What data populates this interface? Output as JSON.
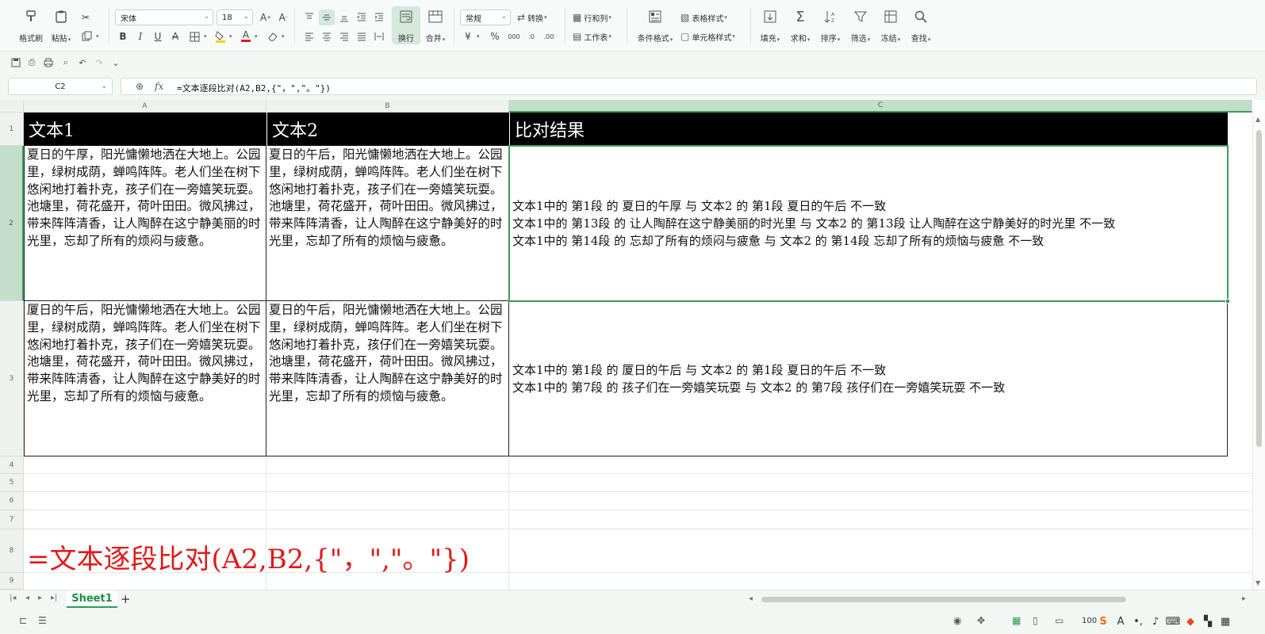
{
  "ribbon": {
    "format_painter": "格式刷",
    "paste": "粘贴",
    "font_name": "宋体",
    "font_size": "18",
    "wrap_text": "换行",
    "merge": "合并",
    "number_format": "常规",
    "convert": "转换",
    "rows_cols": "行和列",
    "worksheet": "工作表",
    "conditional_format": "条件格式",
    "table_style": "表格样式",
    "cell_style": "单元格样式",
    "fill": "填充",
    "sum": "求和",
    "sort": "排序",
    "filter": "筛选",
    "freeze": "冻结",
    "find": "查找",
    "currency_symbol": "¥",
    "percent_symbol": "%"
  },
  "formula_bar": {
    "name_box": "C2",
    "formula": "=文本逐段比对(A2,B2,{\"，\",\"。\"})"
  },
  "columns": [
    "A",
    "B",
    "C"
  ],
  "rows": [
    "1",
    "2",
    "3",
    "4",
    "5",
    "6",
    "7",
    "8",
    "9"
  ],
  "cells": {
    "A1": "文本1",
    "B1": "文本2",
    "C1": "比对结果",
    "A2": "夏日的午厚，阳光慵懒地洒在大地上。公园里，绿树成荫，蝉鸣阵阵。老人们坐在树下悠闲地打着扑克，孩子们在一旁嬉笑玩耍。池塘里，荷花盛开，荷叶田田。微风拂过，带来阵阵清香，让人陶醉在这宁静美丽的时光里，忘却了所有的烦闷与疲惫。",
    "B2": "夏日的午后，阳光慵懒地洒在大地上。公园里，绿树成荫，蝉鸣阵阵。老人们坐在树下悠闲地打着扑克，孩子们在一旁嬉笑玩耍。池塘里，荷花盛开，荷叶田田。微风拂过，带来阵阵清香，让人陶醉在这宁静美好的时光里，忘却了所有的烦恼与疲惫。",
    "C2": [
      "文本1中的 第1段 的 夏日的午厚 与 文本2 的 第1段 夏日的午后 不一致",
      "文本1中的 第13段 的 让人陶醉在这宁静美丽的时光里 与 文本2 的 第13段 让人陶醉在这宁静美好的时光里 不一致",
      "文本1中的 第14段 的 忘却了所有的烦闷与疲惫 与 文本2 的 第14段 忘却了所有的烦恼与疲惫 不一致"
    ],
    "A3": "厦日的午后，阳光慵懒地洒在大地上。公园里，绿树成荫，蝉鸣阵阵。老人们坐在树下悠闲地打着扑克，孩子们在一旁嬉笑玩耍。池塘里，荷花盛开，荷叶田田。微风拂过，带来阵阵清香，让人陶醉在这宁静美好的时光里，忘却了所有的烦恼与疲惫。",
    "B3": "夏日的午后，阳光慵懒地洒在大地上。公园里，绿树成荫，蝉鸣阵阵。老人们坐在树下悠闲地打着扑克，孩仔们在一旁嬉笑玩耍。池塘里，荷花盛开，荷叶田田。微风拂过，带来阵阵清香，让人陶醉在这宁静美好的时光里，忘却了所有的烦恼与疲惫。",
    "C3": [
      "文本1中的 第1段 的 厦日的午后 与 文本2 的 第1段 夏日的午后 不一致",
      "文本1中的 第7段 的 孩子们在一旁嬉笑玩耍 与 文本2 的 第7段 孩仔们在一旁嬉笑玩耍 不一致"
    ],
    "A8": "=文本逐段比对(A2,B2,{\"，\",\"。\"})"
  },
  "sheet_tabs": [
    "Sheet1"
  ],
  "status": {
    "zoom": "100"
  },
  "colors": {
    "accent": "#2a9d53",
    "header_fill": "#000000",
    "big_formula": "#e0191a"
  }
}
